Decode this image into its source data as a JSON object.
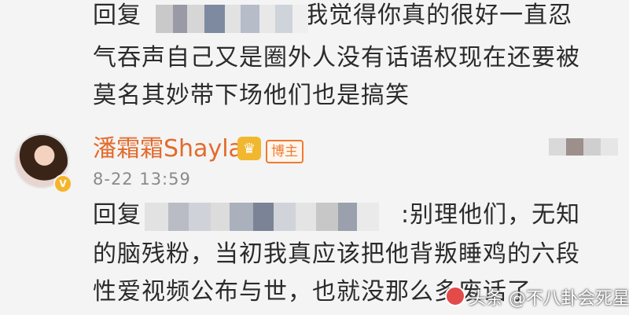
{
  "reply_prev": {
    "prefix": "回复",
    "suffix": ":我觉得你真的很好一直忍",
    "line2": "气吞声自己又是圈外人没有话语权现在还要被",
    "line3": "莫名其妙带下场他们也是搞笑"
  },
  "comment": {
    "username": "潘霜霜Shayla",
    "author_badge": "博主",
    "timestamp": "8-22 13:59",
    "reply_prefix": "回复",
    "reply_suffix": ":别理他们，无知",
    "line2": "的脑残粉，当初我真应该把他背叛睡鸡的六段",
    "line3": "性爱视频公布与世，也就没那么多废话了"
  },
  "icons": {
    "avatar": "profile-photo",
    "verified": "verified-badge-icon",
    "crown": "crown-icon"
  },
  "colors": {
    "username": "#e36b2c",
    "badge": "#f07a30",
    "background": "#f4f4f4"
  },
  "watermark": {
    "text": "头条 @不八卦会死星人"
  }
}
